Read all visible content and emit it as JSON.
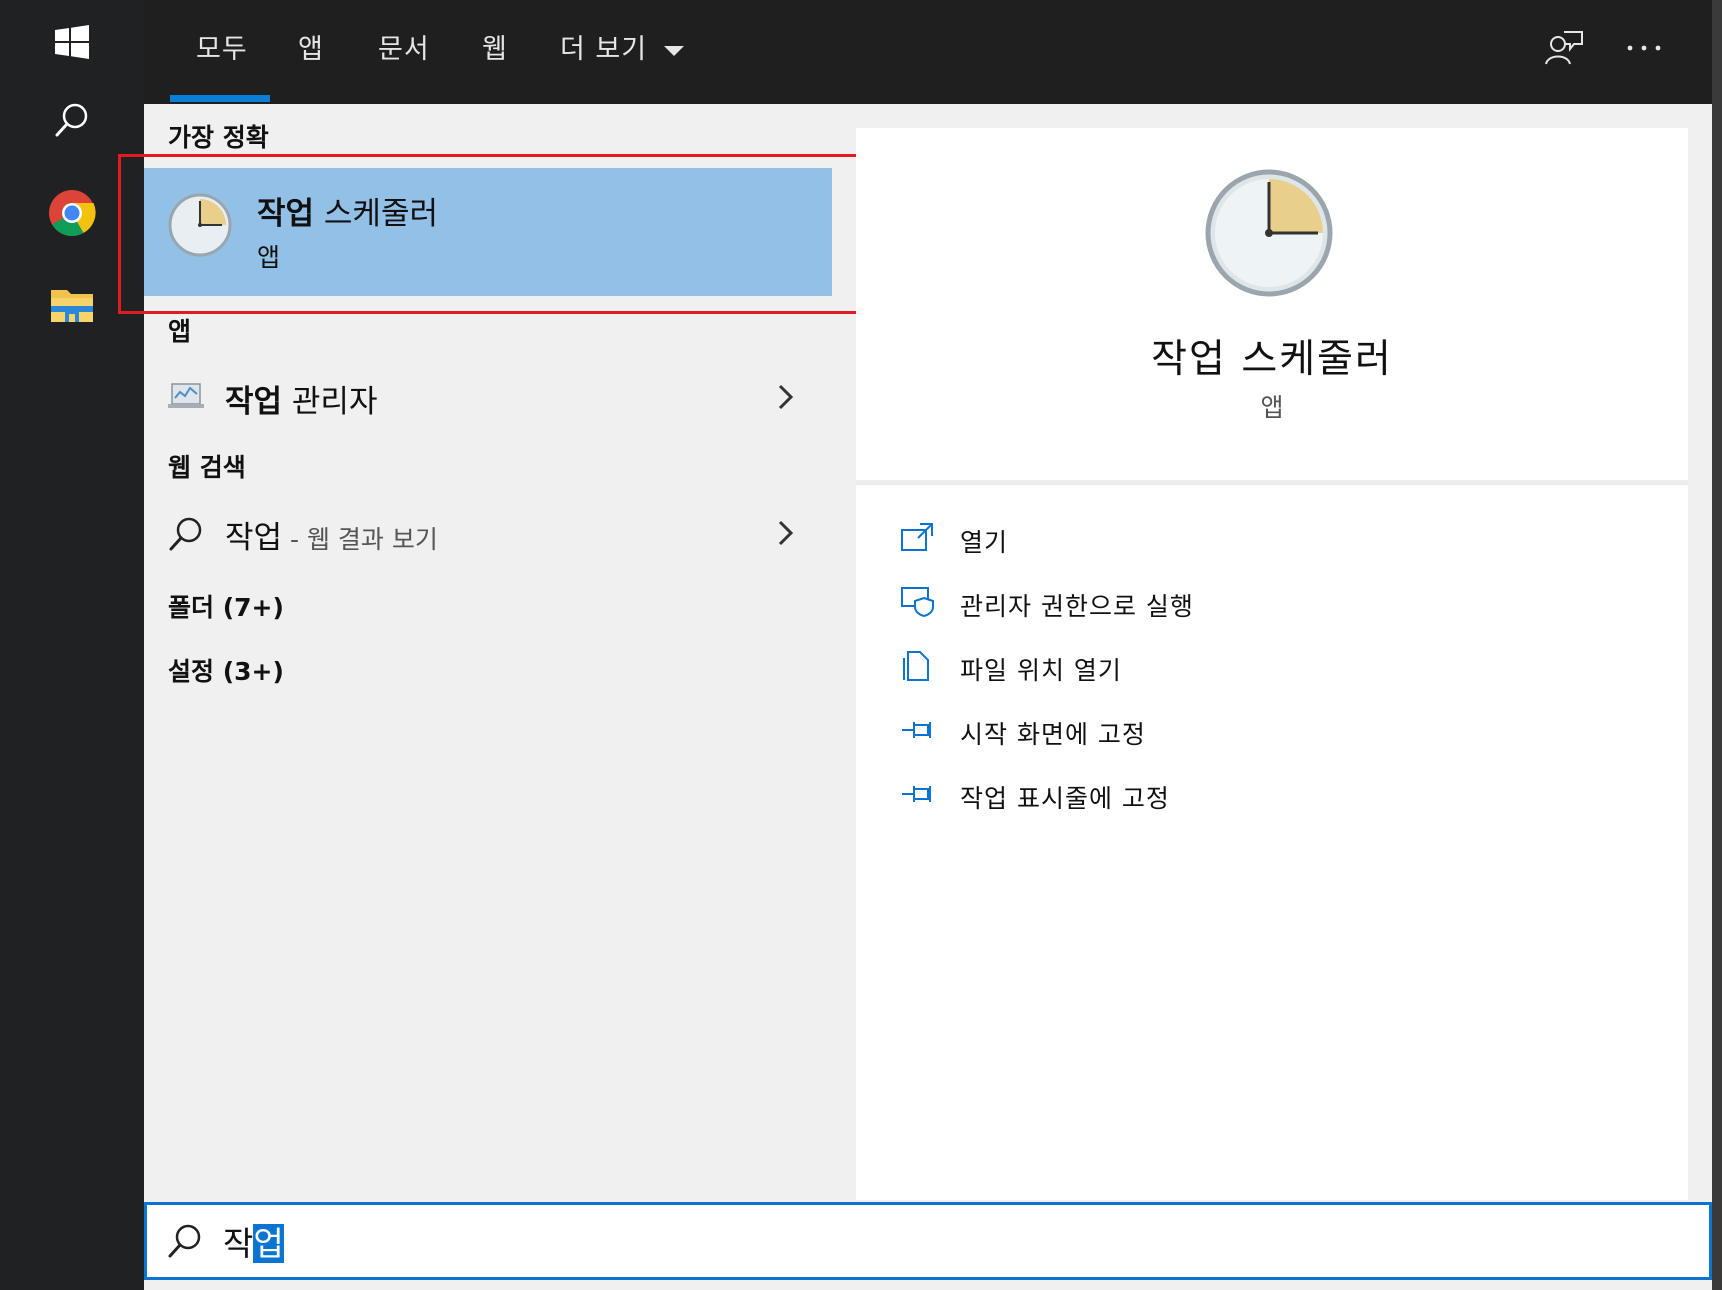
{
  "tabs": [
    {
      "label": "모두",
      "active": true
    },
    {
      "label": "앱"
    },
    {
      "label": "문서"
    },
    {
      "label": "웹"
    },
    {
      "label": "더 보기"
    }
  ],
  "sections": {
    "best_match": "가장 정확",
    "apps": "앱",
    "web_search": "웹 검색",
    "folders": "폴더 (7+)",
    "settings": "설정 (3+)"
  },
  "best_match_item": {
    "bold": "작업",
    "rest": " 스케줄러",
    "type": "앱"
  },
  "app_item": {
    "bold": "작업",
    "rest": " 관리자"
  },
  "web_item": {
    "query": "작업",
    "suffix": " - 웹 결과 보기"
  },
  "preview": {
    "title": "작업 스케줄러",
    "subtitle": "앱"
  },
  "actions": [
    {
      "label": "열기",
      "icon": "open-icon"
    },
    {
      "label": "관리자 권한으로 실행",
      "icon": "admin-shield-icon"
    },
    {
      "label": "파일 위치 열기",
      "icon": "file-location-icon"
    },
    {
      "label": "시작 화면에 고정",
      "icon": "pin-icon"
    },
    {
      "label": "작업 표시줄에 고정",
      "icon": "pin-icon"
    }
  ],
  "search": {
    "typed": "작",
    "composing": "업"
  },
  "colors": {
    "accent": "#0a74d0",
    "highlight": "#92c0e6",
    "callout": "#e21a22"
  }
}
